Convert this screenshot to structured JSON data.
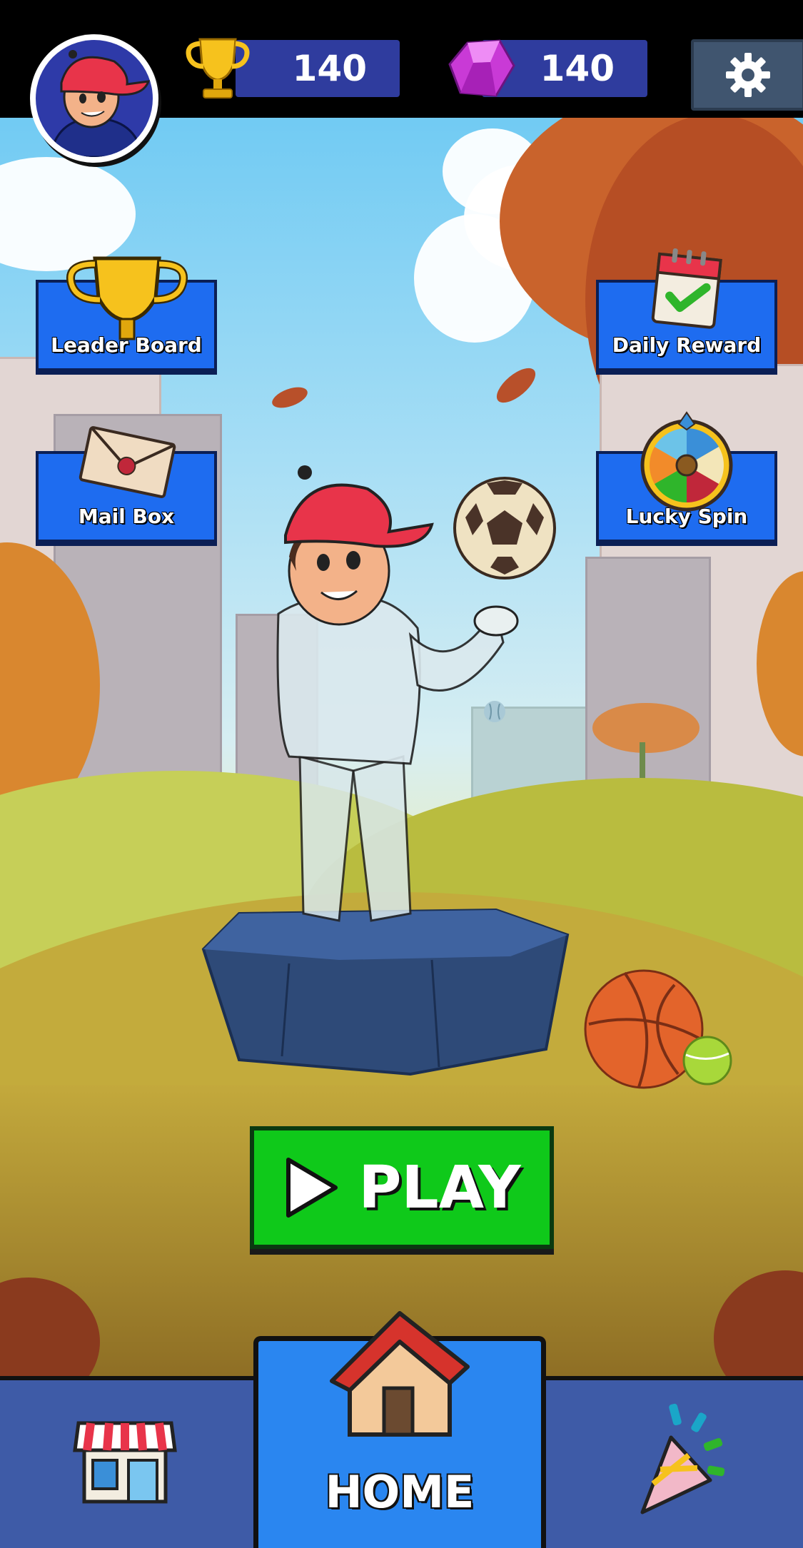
{
  "hud": {
    "trophy_count": "140",
    "gem_count": "140",
    "trophy_icon": "trophy-icon",
    "gem_icon": "gem-icon",
    "settings_icon": "gear-icon"
  },
  "menu": {
    "leaderboard_label": "Leader Board",
    "mailbox_label": "Mail Box",
    "daily_reward_label": "Daily Reward",
    "lucky_spin_label": "Lucky Spin"
  },
  "play": {
    "label": "PLAY"
  },
  "nav": {
    "home_label": "HOME",
    "shop_icon": "shop-icon",
    "home_icon": "house-icon",
    "party_icon": "party-popper-icon"
  },
  "colors": {
    "button_blue": "#1e6cf0",
    "play_green": "#0fc91a",
    "counter_navy": "#2f3c9e",
    "nav_blue": "#3e5ba7"
  }
}
